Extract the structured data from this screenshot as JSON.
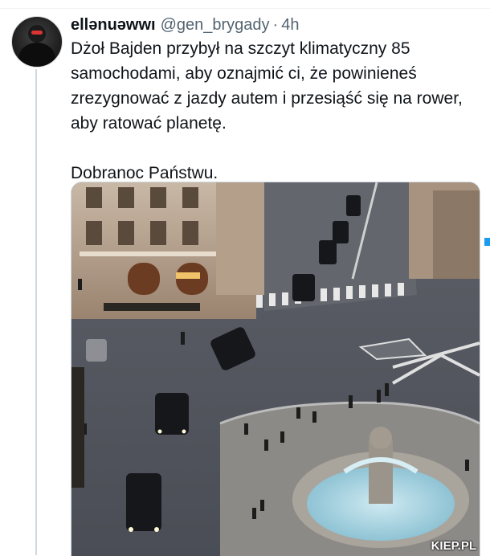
{
  "tweet": {
    "display_name": "ellənuəwwı",
    "handle": "@gen_brygady",
    "separator": "·",
    "time": "4h",
    "text": "Dżoł Bajden przybył na szczyt klimatyczny 85 samochodami, aby oznajmić ci, że powinieneś zrezygnować z jazdy autem i przesiąść się na rower, aby ratować planetę.\n\nDobranoc Państwu."
  },
  "photo": {
    "watermark": "KIEP.PL"
  },
  "colors": {
    "text": "#0f1419",
    "secondary": "#536471",
    "accent": "#1d9bf0"
  },
  "icons": [
    "avatar"
  ]
}
